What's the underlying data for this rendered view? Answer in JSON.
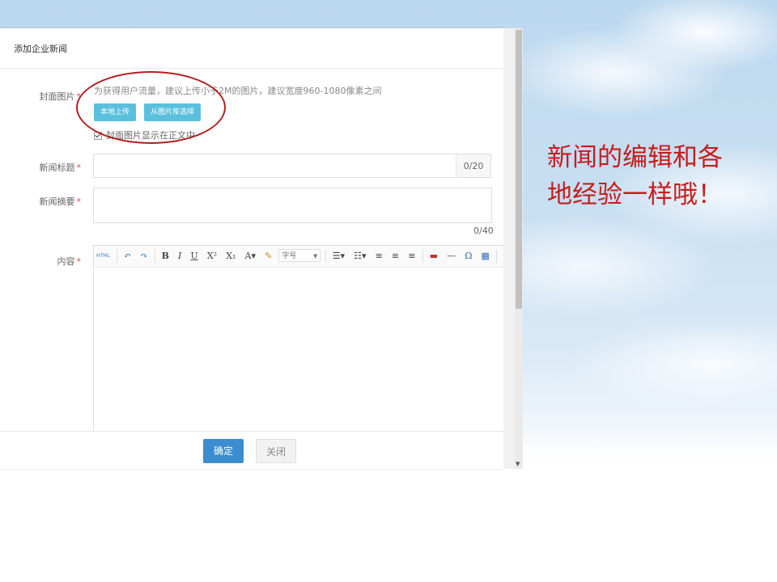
{
  "dialog": {
    "title": "添加企业新闻",
    "cover": {
      "label": "封面图片",
      "required_mark": "*",
      "hint": "为获得用户流量，建议上传小于2M的图片，建议宽度960-1080像素之间",
      "upload_local_label": "本地上传",
      "choose_library_label": "从图片库选择",
      "show_in_body_label": "封面图片显示在正文中",
      "show_in_body_checked": true
    },
    "news_title": {
      "label": "新闻标题",
      "required_mark": "*",
      "value": "",
      "counter": "0/20"
    },
    "news_summary": {
      "label": "新闻摘要",
      "required_mark": "*",
      "value": "",
      "counter": "0/40"
    },
    "content": {
      "label": "内容",
      "required_mark": "*",
      "font_size_placeholder": "字号",
      "toolbar_icons": [
        "html-icon",
        "undo-icon",
        "redo-icon",
        "bold-icon",
        "italic-icon",
        "underline-icon",
        "superscript-icon",
        "subscript-icon",
        "font-color-icon",
        "format-brush-icon",
        "font-size-select",
        "ordered-list-icon",
        "unordered-list-icon",
        "align-left-icon",
        "align-center-icon",
        "align-right-icon",
        "image-icon",
        "horizontal-rule-icon",
        "special-char-icon",
        "table-icon",
        "search-icon",
        "find-replace-icon"
      ]
    },
    "footer": {
      "ok_label": "确定",
      "close_label": "关闭"
    }
  },
  "callout": {
    "text": "新闻的编辑和各地经验一样哦！",
    "color": "#c81c1c"
  },
  "colors": {
    "primary_button": "#3c8dcf",
    "info_button": "#5bc0de",
    "annotation_ellipse": "#b02020"
  }
}
